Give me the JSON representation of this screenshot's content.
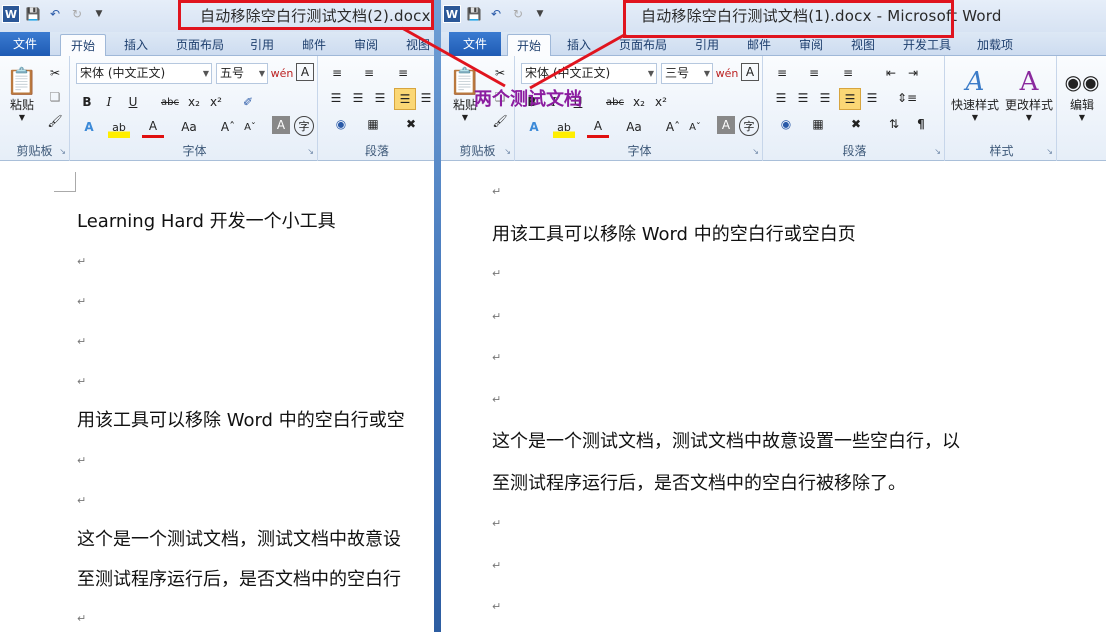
{
  "left_window": {
    "title": "自动移除空白行测试文档(2).docx -",
    "tabs": [
      "文件",
      "开始",
      "插入",
      "页面布局",
      "引用",
      "邮件",
      "审阅",
      "视图"
    ],
    "ribbon": {
      "clipboard": {
        "paste": "粘贴",
        "label": "剪贴板"
      },
      "font": {
        "name": "宋体 (中文正文)",
        "size": "五号",
        "label": "字体"
      },
      "paragraph": {
        "label": "段落"
      }
    },
    "doc": {
      "line1": "Learning Hard 开发一个小工具",
      "line2": "用该工具可以移除 Word 中的空白行或空",
      "line3": "这个是一个测试文档，测试文档中故意设",
      "line4": "至测试程序运行后，是否文档中的空白行"
    }
  },
  "right_window": {
    "title": "自动移除空白行测试文档(1).docx - Microsoft Word",
    "tabs": [
      "文件",
      "开始",
      "插入",
      "页面布局",
      "引用",
      "邮件",
      "审阅",
      "视图",
      "开发工具",
      "加载项"
    ],
    "ribbon": {
      "clipboard": {
        "paste": "粘贴",
        "label": "剪贴板"
      },
      "font": {
        "name": "宋体 (中文正文)",
        "size": "三号",
        "label": "字体"
      },
      "paragraph": {
        "label": "段落"
      },
      "styles": {
        "quick": "快速样式",
        "change": "更改样式",
        "label": "样式"
      },
      "editing": {
        "label": "编辑"
      }
    },
    "doc": {
      "line1": "用该工具可以移除 Word 中的空白行或空白页",
      "line2": "这个是一个测试文档，测试文档中故意设置一些空白行，以",
      "line3": "至测试程序运行后，是否文档中的空白行被移除了。"
    }
  },
  "annotation": "两个测试文档",
  "glyphs": {
    "para_mark": "↵"
  },
  "colors": {
    "annotation_box": "#e0141e",
    "annotation_text": "#8b1ca0",
    "file_tab": "#1f5bb4"
  }
}
